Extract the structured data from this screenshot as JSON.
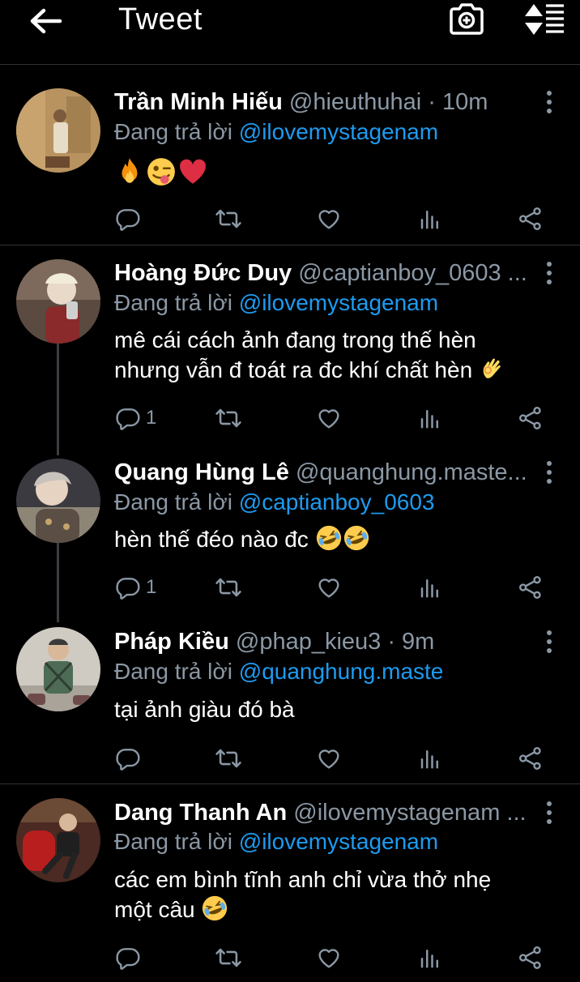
{
  "header": {
    "title": "Tweet"
  },
  "colors": {
    "accent": "#1d9bf0",
    "secondary_text": "#8b98a5",
    "background": "#000000"
  },
  "tweets": [
    {
      "name": "Trần Minh Hiếu",
      "handle_time": "@hieuthuhai · 10m",
      "reply_prefix": "Đang trả lời",
      "reply_mention": "@ilovemystagenam",
      "text": "",
      "emojis": [
        "fire",
        "winking-face-with-tongue",
        "red-heart"
      ],
      "reply_count": ""
    },
    {
      "name": "Hoàng Đức Duy",
      "handle_time": "@captianboy_0603 ...",
      "reply_prefix": "Đang trả lời",
      "reply_mention": "@ilovemystagenam",
      "text_line1": "mê cái cách ảnh đang trong thế hèn",
      "text_line2": "nhưng vẫn đ toát ra đc khí chất hèn",
      "emojis": [
        "ok-hand"
      ],
      "reply_count": "1"
    },
    {
      "name": "Quang Hùng Lê",
      "handle_time": "@quanghung.maste...",
      "reply_prefix": "Đang trả lời",
      "reply_mention": "@captianboy_0603",
      "text_line1": "hèn thế đéo nào đc",
      "emojis": [
        "rolling-laughing",
        "rolling-laughing"
      ],
      "reply_count": "1"
    },
    {
      "name": "Pháp Kiều",
      "handle_time": "@phap_kieu3 · 9m",
      "reply_prefix": "Đang trả lời",
      "reply_mention": "@quanghung.maste",
      "text_line1": "tại ảnh giàu đó bà",
      "reply_count": ""
    },
    {
      "name": "Dang Thanh An",
      "handle_time": "@ilovemystagenam ...",
      "reply_prefix": "Đang trả lời",
      "reply_mention": "@ilovemystagenam",
      "text_line1": "các em bình tĩnh anh chỉ vừa thở nhẹ",
      "text_line2": "một câu",
      "emojis": [
        "rolling-laughing"
      ],
      "reply_count": ""
    }
  ]
}
